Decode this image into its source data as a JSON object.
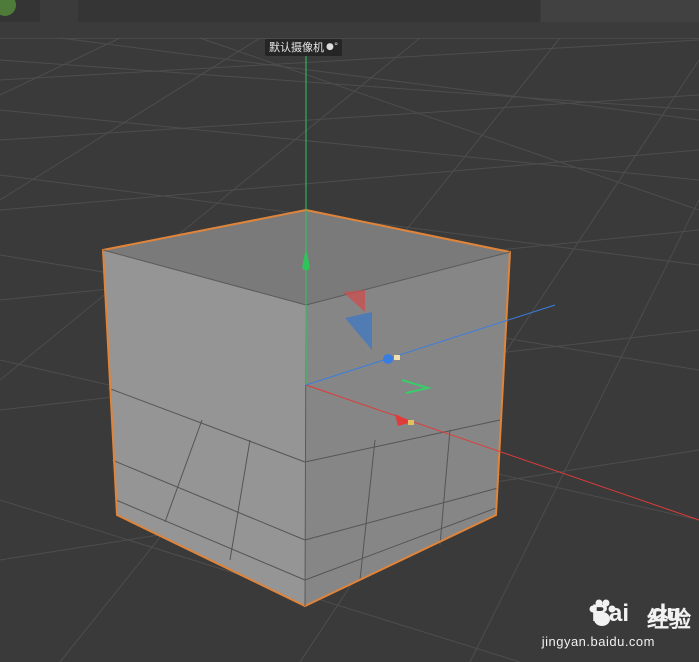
{
  "viewport": {
    "camera_label": "默认摄像机",
    "camera_icon": "camera-icon",
    "background_color": "#3a3a3a",
    "grid_color": "#4d4d4d",
    "cube_fill": "#8e8e8e",
    "cube_outline_color": "#e0843a",
    "axis_colors": {
      "x": "#e03a3a",
      "y": "#2ec45a",
      "z": "#3a7de0"
    }
  },
  "watermark": {
    "brand_logo_text": "Bai du",
    "product": "经验",
    "url": "jingyan.baidu.com"
  }
}
